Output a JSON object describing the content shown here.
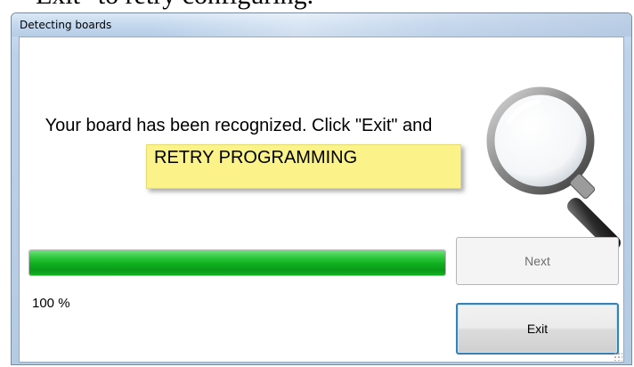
{
  "background_doc": {
    "text": "Exit\" to retry configuring."
  },
  "window": {
    "title": "Detecting boards"
  },
  "main": {
    "message": "Your board has been recognized. Click \"Exit\" and",
    "note_text": "RETRY PROGRAMMING",
    "progress_percent": 100,
    "progress_label": "100 %"
  },
  "buttons": {
    "next_label": "Next",
    "exit_label": "Exit"
  },
  "colors": {
    "progress_green": "#0fae1f",
    "note_yellow": "#fbf38a",
    "focus_border": "#3c7fb1"
  },
  "icons": [
    "magnifier-icon"
  ]
}
